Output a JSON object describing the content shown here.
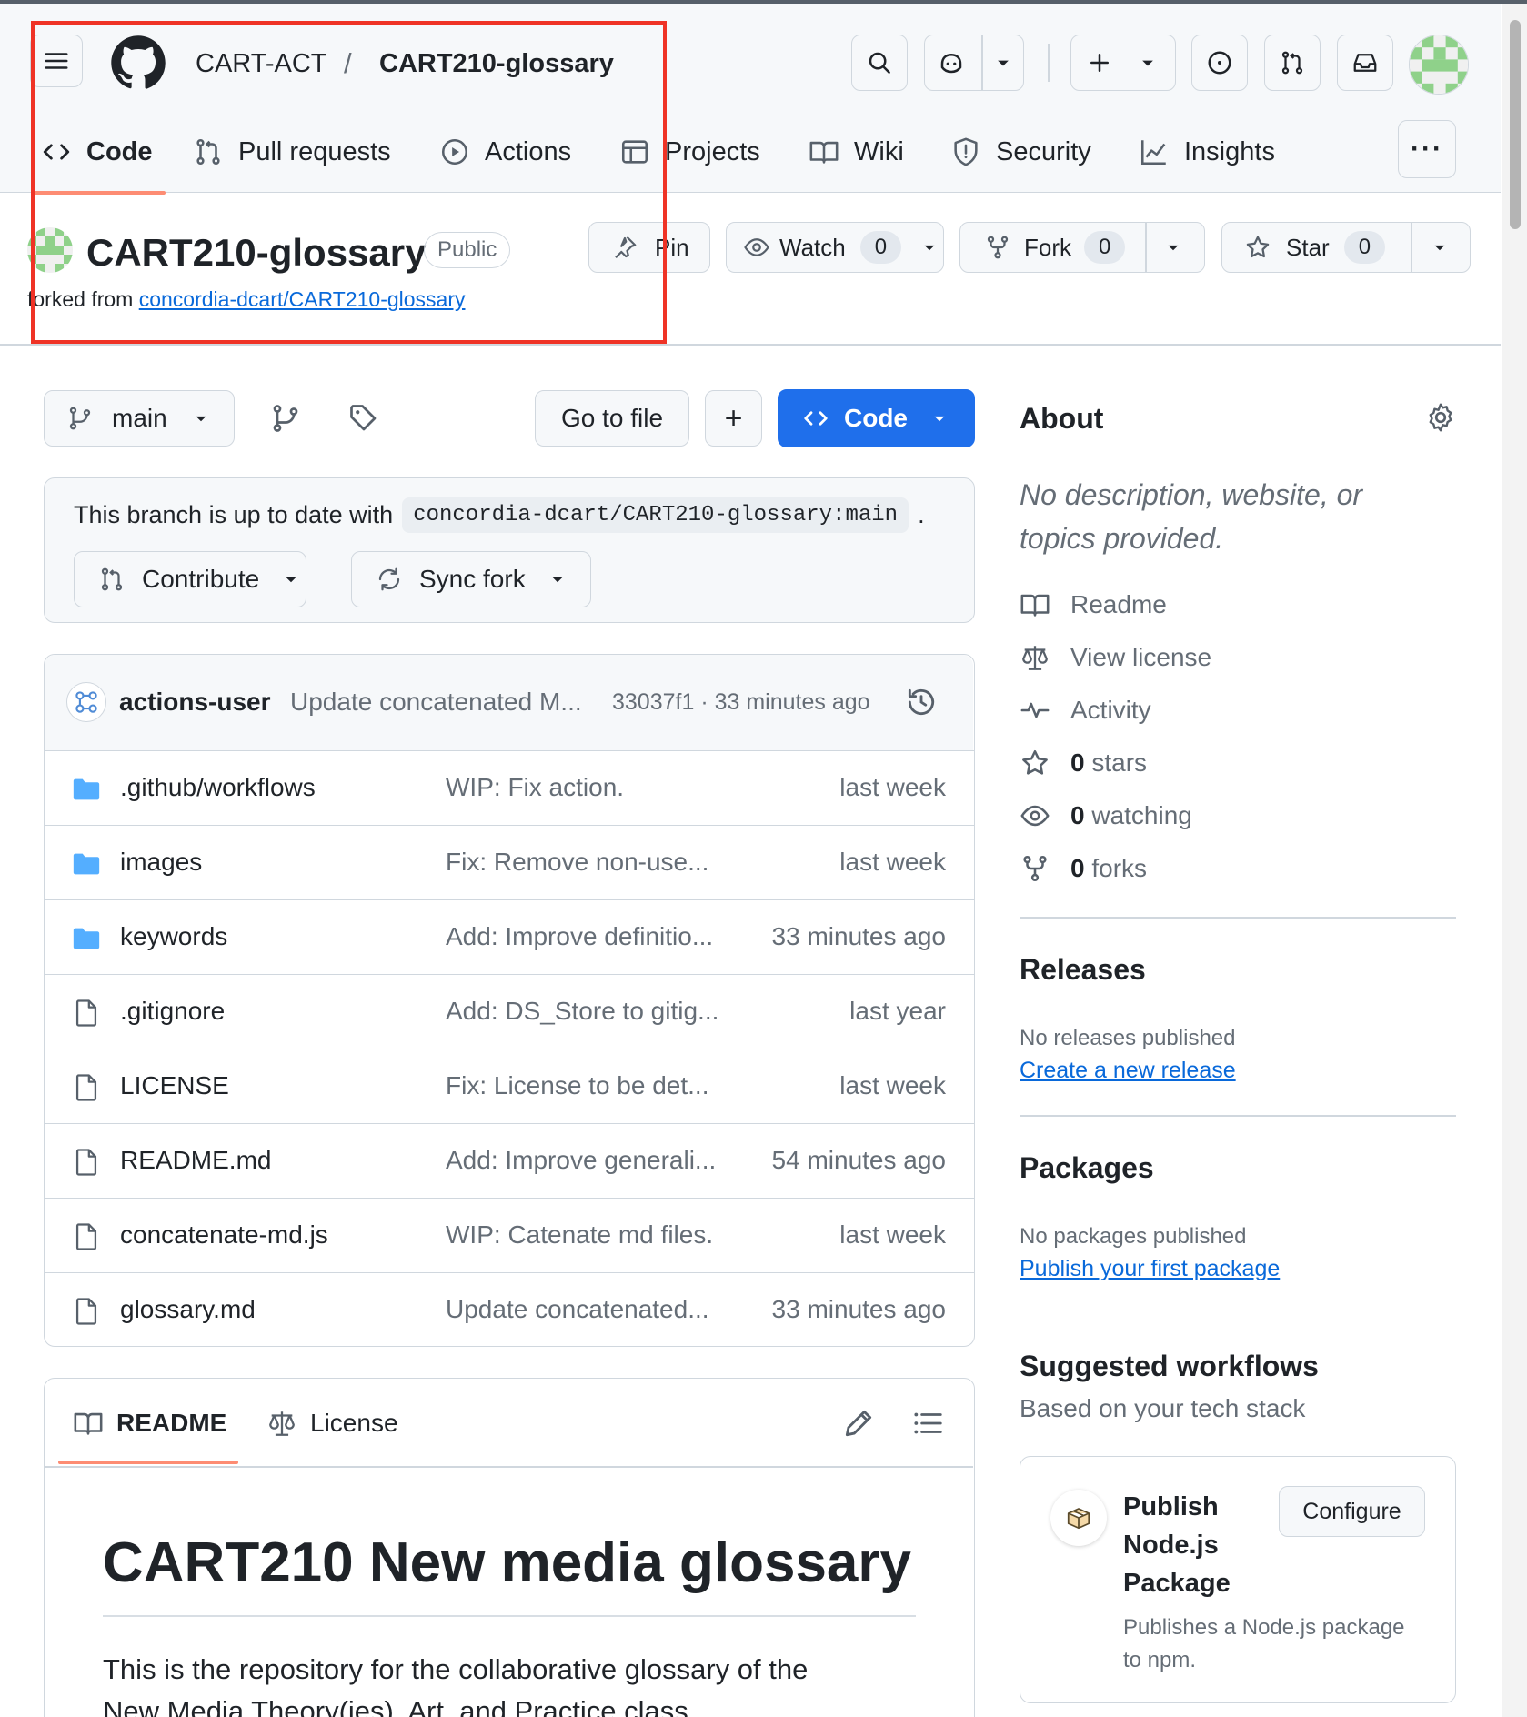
{
  "header": {
    "owner": "CART-ACT",
    "separator": "/",
    "repo": "CART210-glossary",
    "nav_tabs": [
      {
        "label": "Code"
      },
      {
        "label": "Pull requests"
      },
      {
        "label": "Actions"
      },
      {
        "label": "Projects"
      },
      {
        "label": "Wiki"
      },
      {
        "label": "Security"
      },
      {
        "label": "Insights"
      }
    ],
    "more_label": "···"
  },
  "repo_head": {
    "title": "CART210-glossary",
    "visibility": "Public",
    "forked_prefix": "forked from",
    "forked_link": "concordia-dcart/CART210-glossary",
    "pin_label": "Pin",
    "watch_label": "Watch",
    "watch_count": "0",
    "fork_label": "Fork",
    "fork_count": "0",
    "star_label": "Star",
    "star_count": "0"
  },
  "toolbar": {
    "branch": "main",
    "go_to_file": "Go to file",
    "add_label": "+",
    "code_label": "Code"
  },
  "branch_status": {
    "text": "This branch is up to date with",
    "ref": "concordia-dcart/CART210-glossary:main",
    "period": ".",
    "contribute": "Contribute",
    "sync_fork": "Sync fork"
  },
  "commit": {
    "author": "actions-user",
    "message": "Update concatenated M...",
    "meta": "33037f1 · 33 minutes ago"
  },
  "files": [
    {
      "type": "folder",
      "name": ".github/workflows",
      "message": "WIP: Fix action.",
      "date": "last week"
    },
    {
      "type": "folder",
      "name": "images",
      "message": "Fix: Remove non-use...",
      "date": "last week"
    },
    {
      "type": "folder",
      "name": "keywords",
      "message": "Add: Improve definitio...",
      "date": "33 minutes ago"
    },
    {
      "type": "file",
      "name": ".gitignore",
      "message": "Add: DS_Store to gitig...",
      "date": "last year"
    },
    {
      "type": "file",
      "name": "LICENSE",
      "message": "Fix: License to be det...",
      "date": "last week"
    },
    {
      "type": "file",
      "name": "README.md",
      "message": "Add: Improve generali...",
      "date": "54 minutes ago"
    },
    {
      "type": "file",
      "name": "concatenate-md.js",
      "message": "WIP: Catenate md files.",
      "date": "last week"
    },
    {
      "type": "file",
      "name": "glossary.md",
      "message": "Update concatenated...",
      "date": "33 minutes ago"
    }
  ],
  "readme": {
    "tab_readme": "README",
    "tab_license": "License",
    "heading": "CART210 New media glossary",
    "body_line1": "This is the repository for the collaborative glossary of the",
    "body_line2": "New Media Theory(ies), Art, and Practice class."
  },
  "about": {
    "title": "About",
    "description_line1": "No description, website, or",
    "description_line2": "topics provided.",
    "readme": "Readme",
    "license": "View license",
    "activity": "Activity",
    "stars_count": "0",
    "stars_label": "stars",
    "watching_count": "0",
    "watching_label": "watching",
    "forks_count": "0",
    "forks_label": "forks"
  },
  "releases": {
    "title": "Releases",
    "none": "No releases published",
    "create": "Create a new release"
  },
  "packages": {
    "title": "Packages",
    "none": "No packages published",
    "publish": "Publish your first package"
  },
  "workflows": {
    "title": "Suggested workflows",
    "subtitle": "Based on your tech stack",
    "card_title_1": "Publish",
    "card_title_2": "Node.js",
    "card_title_3": "Package",
    "configure": "Configure",
    "card_desc_1": "Publishes a Node.js package",
    "card_desc_2": "to npm."
  },
  "colors": {
    "accent_blue": "#0969da",
    "code_button": "#1f6feb",
    "tab_underline": "#fd8c73",
    "folder": "#54aeff",
    "annotation_red": "#ef3326"
  }
}
